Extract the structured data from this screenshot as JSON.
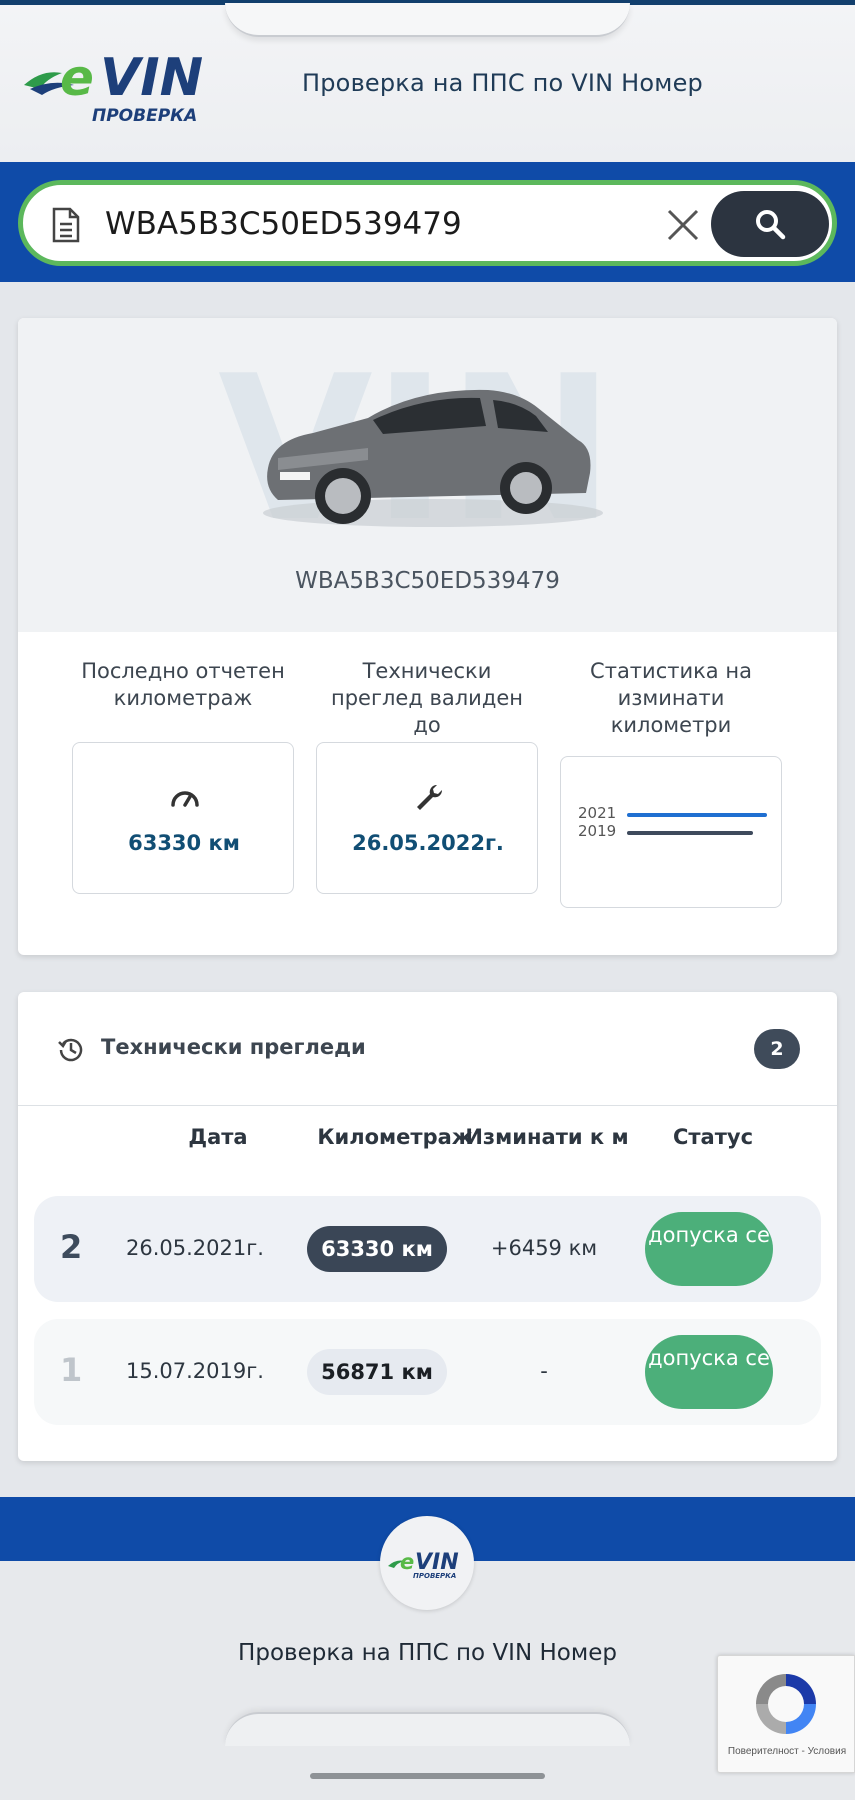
{
  "header": {
    "logo_text": "eVIN",
    "logo_subtext": "ПРОВЕРКА",
    "title": "Проверка на ППС по VIN Номер"
  },
  "search": {
    "value": "WBA5B3C50ED539479",
    "placeholder": ""
  },
  "vehicle": {
    "vin": "WBA5B3C50ED539479",
    "watermark": "VIN"
  },
  "stats": {
    "mileage_label": "Последно отчетен километраж",
    "mileage_value": "63330 км",
    "inspection_label": "Технически преглед валиден до",
    "inspection_value": "26.05.2022г.",
    "chart_label": "Статистика на изминати километри"
  },
  "chart_data": {
    "type": "bar",
    "orientation": "horizontal",
    "categories": [
      "2021",
      "2019"
    ],
    "values": [
      63330,
      56871
    ],
    "colors": [
      "#1f6fd1",
      "#3e4a5c"
    ],
    "title": "",
    "xlabel": "",
    "ylabel": ""
  },
  "inspections": {
    "title": "Технически прегледи",
    "count": "2",
    "columns": {
      "date": "Дата",
      "mileage": "Километраж",
      "traveled": "Изминати к м",
      "status": "Статус"
    },
    "rows": [
      {
        "num": "2",
        "date": "26.05.2021г.",
        "mileage": "63330 км",
        "traveled": "+6459 км",
        "status": "допуска се"
      },
      {
        "num": "1",
        "date": "15.07.2019г.",
        "mileage": "56871 км",
        "traveled": "-",
        "status": "допуска се"
      }
    ]
  },
  "footer": {
    "logo_text": "eVIN",
    "title": "Проверка на ППС по VIN Номер"
  },
  "recaptcha": {
    "links": "Поверителност - Условия"
  },
  "colors": {
    "brand_blue": "#0f4ba8",
    "brand_green": "#5cb85c",
    "status_green": "#4caf7a",
    "dark": "#2c3440"
  },
  "icons": [
    "document-icon",
    "close-icon",
    "search-icon",
    "speedometer-icon",
    "wrench-icon",
    "history-icon",
    "recaptcha-icon"
  ]
}
